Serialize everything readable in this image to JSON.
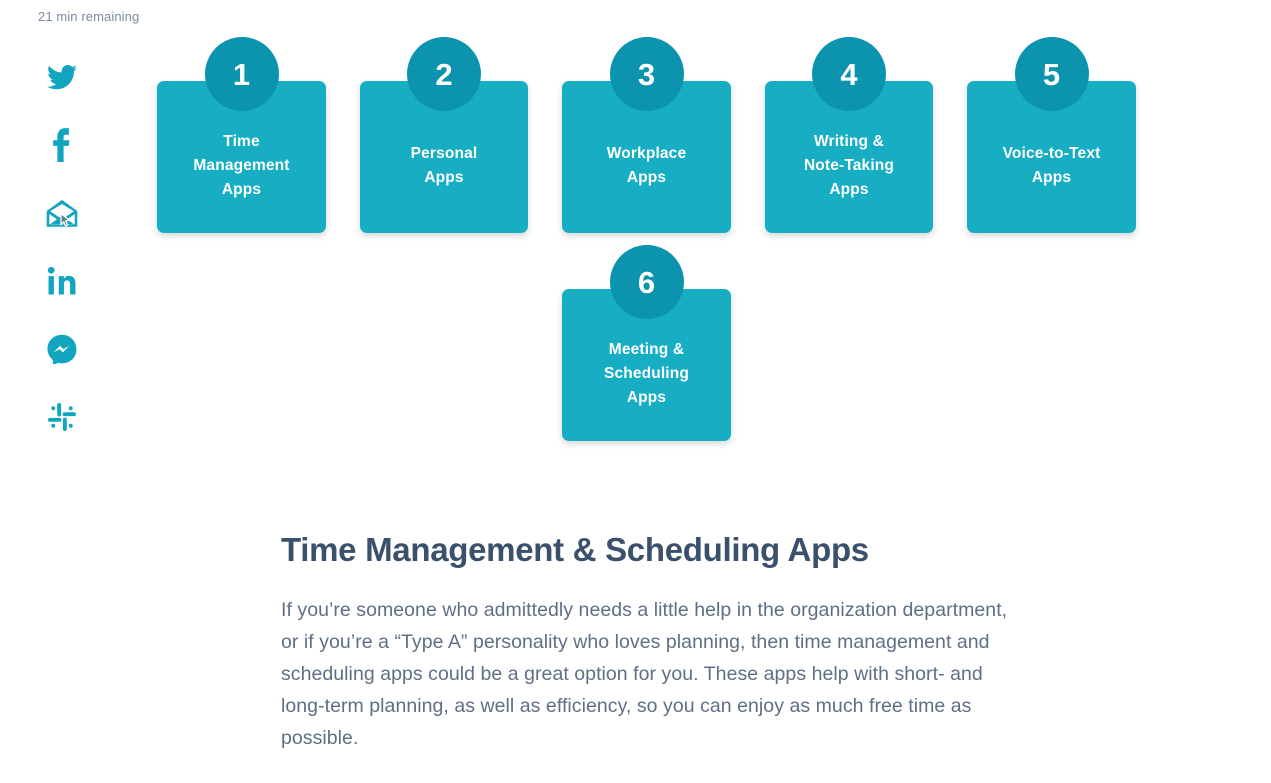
{
  "reading_progress": {
    "text": "21 min remaining"
  },
  "colors": {
    "card_fill": "#17aec4",
    "badge_fill": "#0c94ae",
    "card_text": "#ffffff",
    "heading": "#3b506b",
    "body_text": "#5f6f86",
    "progress_text": "#7b8a9c",
    "social_icon": "#12a5bf"
  },
  "social_share": {
    "items": [
      {
        "icon": "twitter-icon",
        "label": "Share on Twitter"
      },
      {
        "icon": "facebook-icon",
        "label": "Share on Facebook"
      },
      {
        "icon": "email-icon",
        "label": "Share by Email"
      },
      {
        "icon": "linkedin-icon",
        "label": "Share on LinkedIn"
      },
      {
        "icon": "messenger-icon",
        "label": "Share on Messenger"
      },
      {
        "icon": "slack-icon",
        "label": "Share on Slack"
      }
    ]
  },
  "cards": [
    {
      "number": "1",
      "title": "Time\nManagement\nApps"
    },
    {
      "number": "2",
      "title": "Personal\nApps"
    },
    {
      "number": "3",
      "title": "Workplace\nApps"
    },
    {
      "number": "4",
      "title": "Writing &\nNote-Taking\nApps"
    },
    {
      "number": "5",
      "title": "Voice-to-Text\nApps"
    },
    {
      "number": "6",
      "title": "Meeting &\nScheduling\nApps"
    }
  ],
  "article": {
    "heading": "Time Management & Scheduling Apps",
    "paragraph": "If you’re someone who admittedly needs a little help in the organization department, or if you’re a “Type A” personality who loves planning, then time management and scheduling apps could be a great option for you. These apps help with short- and long-term planning, as well as efficiency, so you can enjoy as much free time as possible."
  }
}
